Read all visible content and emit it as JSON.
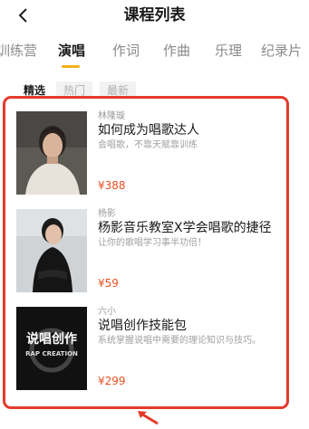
{
  "header": {
    "title": "课程列表"
  },
  "tabs": [
    {
      "label": "训练营"
    },
    {
      "label": "演唱"
    },
    {
      "label": "作词"
    },
    {
      "label": "作曲"
    },
    {
      "label": "乐理"
    },
    {
      "label": "纪录片"
    }
  ],
  "active_tab": "演唱",
  "filters": [
    {
      "label": "精选"
    },
    {
      "label": "热门"
    },
    {
      "label": "最新"
    }
  ],
  "courses": [
    {
      "teacher": "林隆璇",
      "title": "如何成为唱歌达人",
      "desc": "会唱歌，不靠天赋靠训练",
      "price": "¥388"
    },
    {
      "teacher": "杨影",
      "title": "杨影音乐教室X学会唱歌的捷径",
      "desc": "让你的歌唱学习事半功倍！",
      "price": "¥59"
    },
    {
      "teacher": "六小",
      "title": "说唱创作技能包",
      "desc": "系统掌握说唱中需要的理论知识与技巧。",
      "price": "¥299",
      "cover_text": [
        "说唱创作",
        "RAP CREATION"
      ]
    }
  ],
  "colors": {
    "accent": "#f5b01a",
    "highlight_border": "#e43a2a",
    "price": "#e8501f"
  }
}
